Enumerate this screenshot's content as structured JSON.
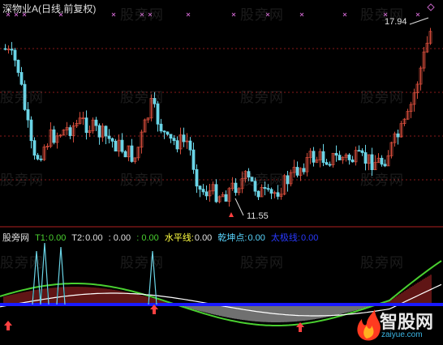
{
  "header": {
    "title": "深物业A(日线,前复权)"
  },
  "watermark": "股旁网",
  "price_labels": {
    "high": "17.94",
    "low": "11.55"
  },
  "indicator": {
    "name": "股旁网",
    "t1_label": "T1:",
    "t1_value": "0.00",
    "t2_label": "T2:",
    "t2_value": "0.00",
    "sep1": ": 0.00",
    "sep2": ": 0.00",
    "level_label": "水平线:",
    "level_value": "0.00",
    "qk_label": "乾坤点:",
    "qk_value": "0.00",
    "ty_label": "太极线:",
    "ty_value": "0.00"
  },
  "logo": {
    "name": "智股网",
    "url": "zaiyue.com"
  },
  "colors": {
    "up": "#d24b3a",
    "down": "#6ad4e6",
    "grid": "#8a1a1a",
    "blue_line": "#1a1aff",
    "green_line": "#4ad030",
    "white_line": "#ffffff",
    "marker": "#c060c0",
    "arrow": "#ff4040"
  }
}
